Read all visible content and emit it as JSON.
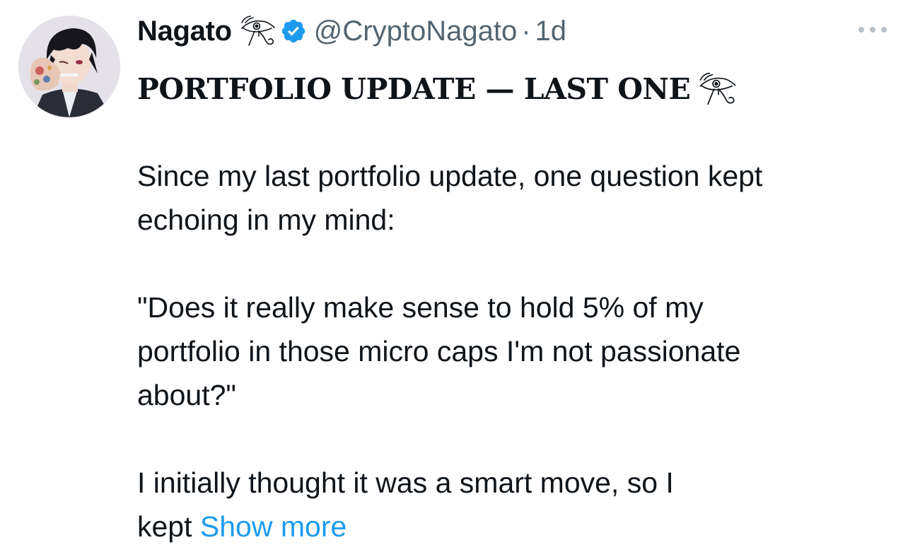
{
  "author": {
    "display_name": "Nagato",
    "handle": "@CryptoNagato",
    "separator": "·",
    "time": "1d",
    "verified": true
  },
  "tweet": {
    "headline": "PORTFOLIO UPDATE — LAST ONE",
    "line1": "Since my last portfolio update, one question kept",
    "line2": "echoing in my mind:",
    "line3": "\"Does it really make sense to hold 5% of my",
    "line4": "portfolio in those micro caps I'm not passionate",
    "line5": "about?\"",
    "line6": "I initially thought it was a smart move, so I",
    "line7": "kept",
    "show_more": "Show more"
  },
  "colors": {
    "text": "#0f1419",
    "secondary": "#536471",
    "link": "#1d9bf0",
    "verified_badge": "#1d9bf0"
  },
  "icons": {
    "name_glyph": "eye-of-horus-icon",
    "verified": "verified-badge-icon",
    "more": "more-options-icon"
  }
}
